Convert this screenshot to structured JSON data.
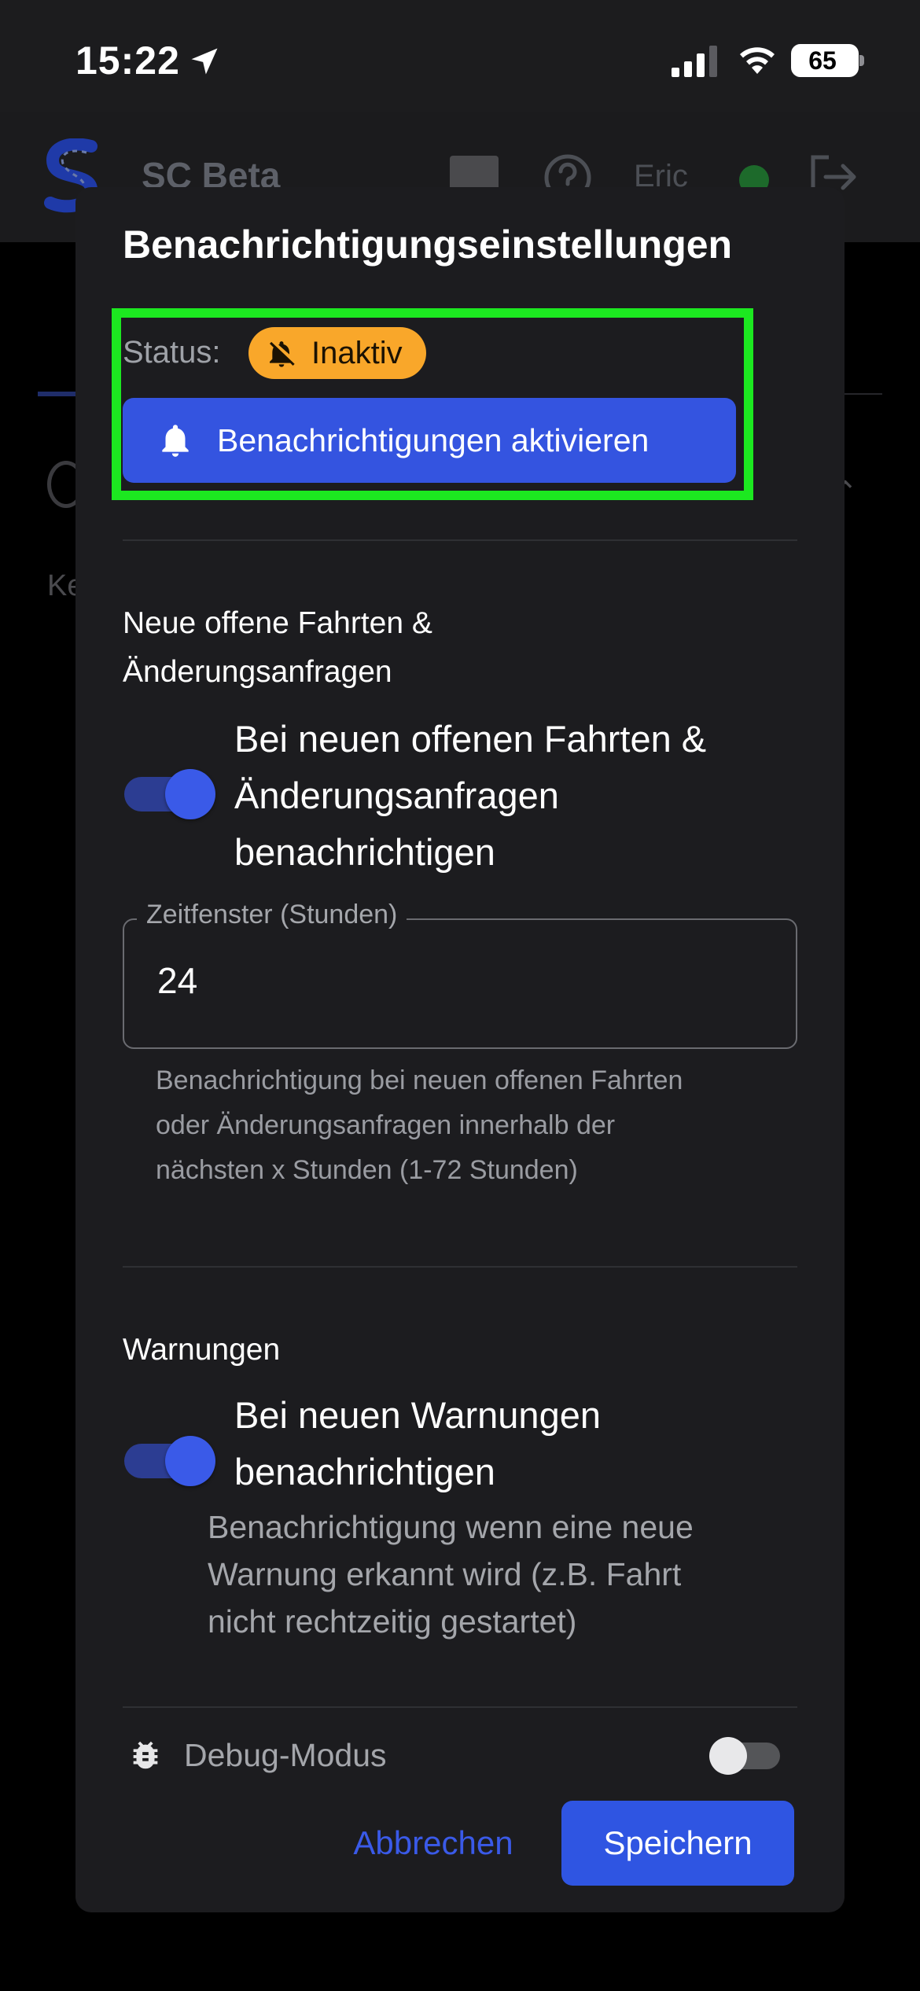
{
  "status_bar": {
    "time": "15:22",
    "battery": "65",
    "icons": [
      "location-arrow-icon",
      "cellular-signal-icon",
      "wifi-icon",
      "battery-icon"
    ]
  },
  "app_bar": {
    "title": "SC Beta",
    "user": "Eric",
    "icons": [
      "app-logo-icon",
      "help-icon",
      "online-status-icon",
      "logout-icon"
    ]
  },
  "background": {
    "partial_text": "Ke"
  },
  "dialog": {
    "title": "Benachrichtigungseinstellungen",
    "status_label": "Status:",
    "status_value": "Inaktiv",
    "activate_button": "Benachrichtigungen aktivieren",
    "section_open_rides": {
      "title_line1": "Neue offene Fahrten &",
      "title_line2": "Änderungsanfragen",
      "toggle_line1": "Bei neuen offenen Fahrten &",
      "toggle_line2": "Änderungsanfragen",
      "toggle_line3": "benachrichtigen",
      "toggle_on": true,
      "field_label": "Zeitfenster (Stunden)",
      "field_value": "24",
      "helper_line1": "Benachrichtigung bei neuen offenen Fahrten",
      "helper_line2": "oder Änderungsanfragen innerhalb der",
      "helper_line3": "nächsten x Stunden (1-72 Stunden)"
    },
    "section_warnings": {
      "title": "Warnungen",
      "toggle_line1": "Bei neuen Warnungen",
      "toggle_line2": "benachrichtigen",
      "toggle_on": true,
      "desc_line1": "Benachrichtigung wenn eine neue",
      "desc_line2": "Warnung erkannt wird (z.B. Fahrt",
      "desc_line3": "nicht rechtzeitig gestartet)"
    },
    "debug_label": "Debug-Modus",
    "debug_on": false,
    "cancel_button": "Abbrechen",
    "save_button": "Speichern"
  },
  "colors": {
    "accent": "#3454e0",
    "status_chip": "#f9a72a",
    "highlight_box": "#1ce820",
    "dialog_bg": "#1c1c1f"
  }
}
